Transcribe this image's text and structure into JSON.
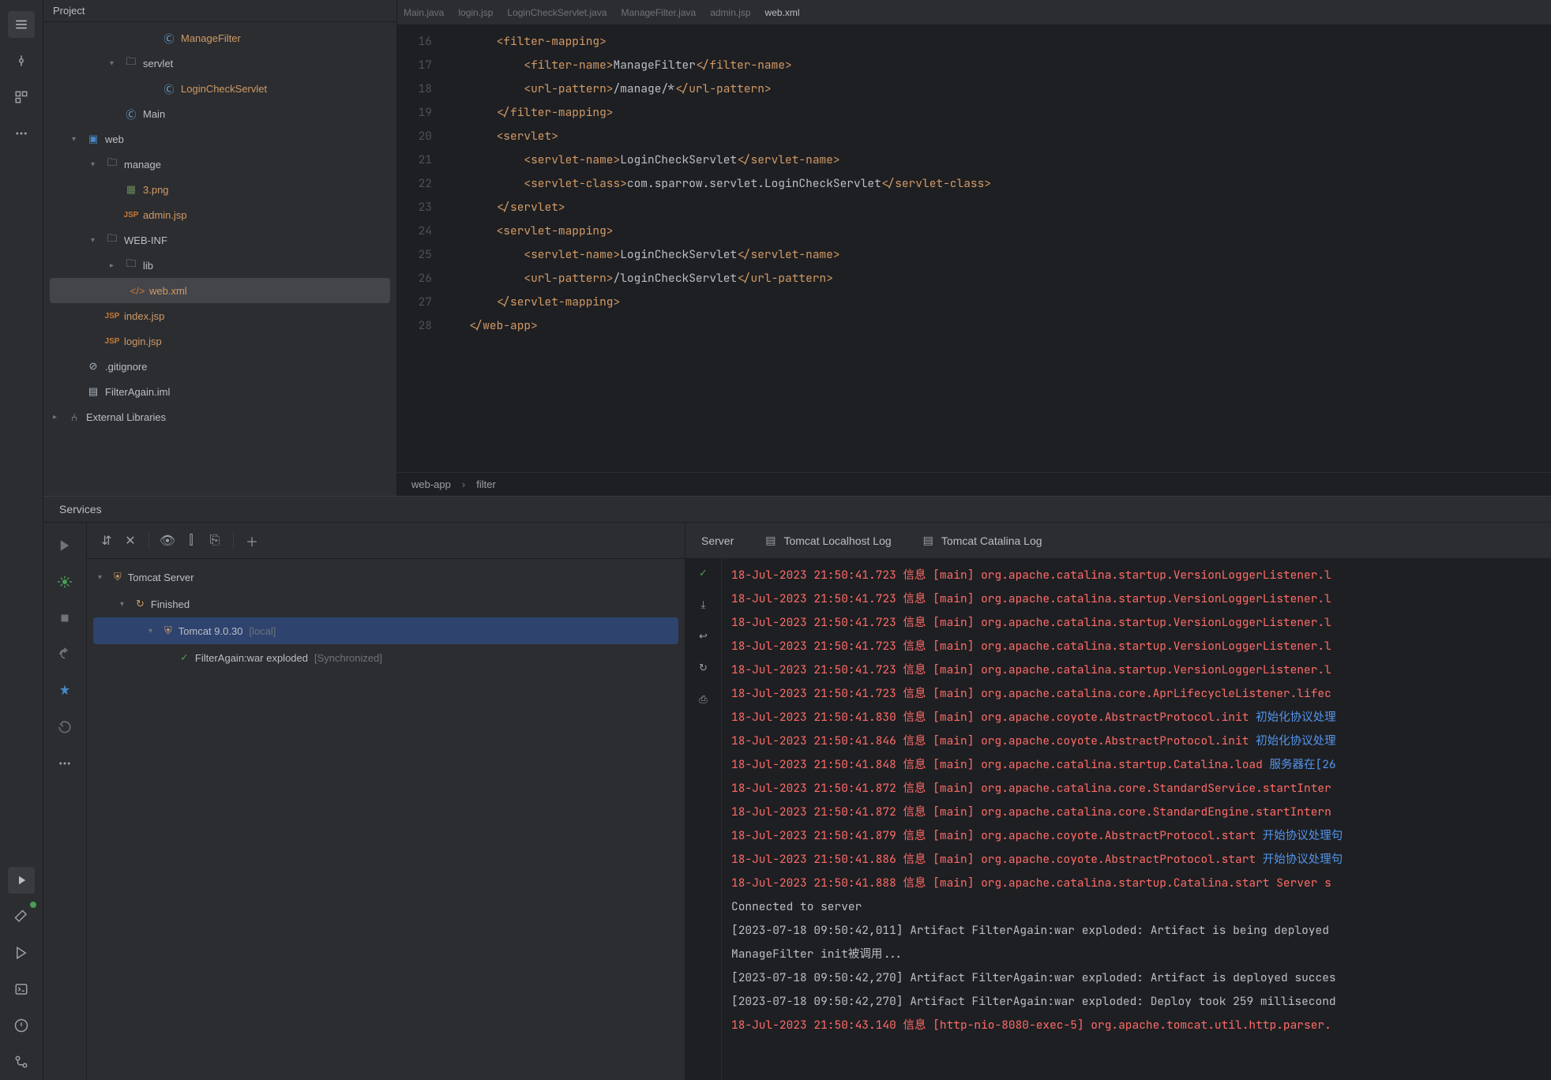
{
  "project": {
    "title": "Project",
    "tree": [
      {
        "indent": 5,
        "chev": "none",
        "iconClass": "class",
        "icon": "Ⓒ",
        "label": "ManageFilter",
        "labelClass": "orange"
      },
      {
        "indent": 3,
        "chev": "down",
        "iconClass": "folder",
        "icon": "🗀",
        "label": "servlet"
      },
      {
        "indent": 5,
        "chev": "none",
        "iconClass": "class",
        "icon": "Ⓒ",
        "label": "LoginCheckServlet",
        "labelClass": "orange"
      },
      {
        "indent": 3,
        "chev": "none",
        "iconClass": "class",
        "icon": "Ⓒ",
        "label": "Main"
      },
      {
        "indent": 1,
        "chev": "down",
        "iconClass": "web",
        "icon": "▣",
        "label": "web"
      },
      {
        "indent": 2,
        "chev": "down",
        "iconClass": "folder",
        "icon": "🗀",
        "label": "manage"
      },
      {
        "indent": 3,
        "chev": "none",
        "iconClass": "img",
        "icon": "▦",
        "label": "3.png",
        "labelClass": "orange"
      },
      {
        "indent": 3,
        "chev": "none",
        "iconClass": "jsp",
        "icon": "JSP",
        "label": "admin.jsp",
        "labelClass": "orange"
      },
      {
        "indent": 2,
        "chev": "down",
        "iconClass": "folder",
        "icon": "🗀",
        "label": "WEB-INF"
      },
      {
        "indent": 3,
        "chev": "right",
        "iconClass": "folder",
        "icon": "🗀",
        "label": "lib"
      },
      {
        "indent": 3,
        "chev": "none",
        "iconClass": "xml",
        "icon": "</>",
        "label": "web.xml",
        "highlighted": true,
        "labelClass": "orange"
      },
      {
        "indent": 2,
        "chev": "none",
        "iconClass": "jsp",
        "icon": "JSP",
        "label": "index.jsp",
        "labelClass": "orange"
      },
      {
        "indent": 2,
        "chev": "none",
        "iconClass": "jsp",
        "icon": "JSP",
        "label": "login.jsp",
        "labelClass": "orange"
      },
      {
        "indent": 1,
        "chev": "none",
        "iconClass": "lib",
        "icon": "⊘",
        "label": ".gitignore"
      },
      {
        "indent": 1,
        "chev": "none",
        "iconClass": "lib",
        "icon": "▤",
        "label": "FilterAgain.iml"
      },
      {
        "indent": 0,
        "chev": "right",
        "iconClass": "lib",
        "icon": "⑃",
        "label": "External Libraries"
      }
    ]
  },
  "editor": {
    "tabs": [
      "Main.java",
      "login.jsp",
      "LoginCheckServlet.java",
      "ManageFilter.java",
      "admin.jsp",
      "web.xml"
    ],
    "activeTab": 5,
    "startLine": 16,
    "lines": [
      {
        "ind": 2,
        "t": "filter-mapping"
      },
      {
        "ind": 3,
        "t": "filter-name",
        "txt": "ManageFilter",
        "c": "filter-name"
      },
      {
        "ind": 3,
        "t": "url-pattern",
        "txt": "/manage/*",
        "c": "url-pattern"
      },
      {
        "ind": 2,
        "tc": "filter-mapping"
      },
      {
        "ind": 2,
        "t": "servlet"
      },
      {
        "ind": 3,
        "t": "servlet-name",
        "txt": "LoginCheckServlet",
        "c": "servlet-name"
      },
      {
        "ind": 3,
        "t": "servlet-class",
        "txt": "com.sparrow.servlet.LoginCheckServlet",
        "c": "servlet-class"
      },
      {
        "ind": 2,
        "tc": "servlet"
      },
      {
        "ind": 2,
        "t": "servlet-mapping"
      },
      {
        "ind": 3,
        "t": "servlet-name",
        "txt": "LoginCheckServlet",
        "c": "servlet-name"
      },
      {
        "ind": 3,
        "t": "url-pattern",
        "txt": "/loginCheckServlet",
        "c": "url-pattern"
      },
      {
        "ind": 2,
        "tc": "servlet-mapping"
      },
      {
        "ind": 1,
        "tc": "web-app"
      }
    ],
    "breadcrumb": [
      "web-app",
      "filter"
    ]
  },
  "services": {
    "title": "Services",
    "tabs": {
      "server": "Server",
      "localhost": "Tomcat Localhost Log",
      "catalina": "Tomcat Catalina Log"
    },
    "tree": [
      {
        "indent": 0,
        "chev": "down",
        "icon": "⛨",
        "label": "Tomcat Server"
      },
      {
        "indent": 1,
        "chev": "down",
        "icon": "↻",
        "label": "Finished"
      },
      {
        "indent": 2,
        "chev": "down",
        "icon": "⛨",
        "label": "Tomcat 9.0.30",
        "suffix": "[local]",
        "selected": true
      },
      {
        "indent": 3,
        "chev": "none",
        "icon": "✓",
        "label": "FilterAgain:war exploded",
        "suffix": "[Synchronized]"
      }
    ],
    "log": [
      {
        "red": true,
        "text": "18-Jul-2023 21:50:41.723 信息 [main] org.apache.catalina.startup.VersionLoggerListener.l"
      },
      {
        "red": true,
        "text": "18-Jul-2023 21:50:41.723 信息 [main] org.apache.catalina.startup.VersionLoggerListener.l"
      },
      {
        "red": true,
        "text": "18-Jul-2023 21:50:41.723 信息 [main] org.apache.catalina.startup.VersionLoggerListener.l"
      },
      {
        "red": true,
        "text": "18-Jul-2023 21:50:41.723 信息 [main] org.apache.catalina.startup.VersionLoggerListener.l"
      },
      {
        "red": true,
        "text": "18-Jul-2023 21:50:41.723 信息 [main] org.apache.catalina.startup.VersionLoggerListener.l"
      },
      {
        "red": true,
        "text": "18-Jul-2023 21:50:41.723 信息 [main] org.apache.catalina.core.AprLifecycleListener.lifec"
      },
      {
        "red": true,
        "text": "18-Jul-2023 21:50:41.830 信息 [main] org.apache.coyote.AbstractProtocol.init ",
        "zh": "初始化协议处理"
      },
      {
        "red": true,
        "text": "18-Jul-2023 21:50:41.846 信息 [main] org.apache.coyote.AbstractProtocol.init ",
        "zh": "初始化协议处理"
      },
      {
        "red": true,
        "text": "18-Jul-2023 21:50:41.848 信息 [main] org.apache.catalina.startup.Catalina.load ",
        "zh": "服务器在[26"
      },
      {
        "red": true,
        "text": "18-Jul-2023 21:50:41.872 信息 [main] org.apache.catalina.core.StandardService.startInter"
      },
      {
        "red": true,
        "text": "18-Jul-2023 21:50:41.872 信息 [main] org.apache.catalina.core.StandardEngine.startIntern"
      },
      {
        "red": true,
        "text": "18-Jul-2023 21:50:41.879 信息 [main] org.apache.coyote.AbstractProtocol.start ",
        "zh": "开始协议处理句"
      },
      {
        "red": true,
        "text": "18-Jul-2023 21:50:41.886 信息 [main] org.apache.coyote.AbstractProtocol.start ",
        "zh": "开始协议处理句"
      },
      {
        "red": true,
        "text": "18-Jul-2023 21:50:41.888 信息 [main] org.apache.catalina.startup.Catalina.start Server s"
      },
      {
        "red": false,
        "text": "Connected to server"
      },
      {
        "red": false,
        "text": "[2023-07-18 09:50:42,011] Artifact FilterAgain:war exploded: Artifact is being deployed"
      },
      {
        "red": false,
        "text": "ManageFilter init被调用..."
      },
      {
        "red": false,
        "text": "[2023-07-18 09:50:42,270] Artifact FilterAgain:war exploded: Artifact is deployed succes"
      },
      {
        "red": false,
        "text": "[2023-07-18 09:50:42,270] Artifact FilterAgain:war exploded: Deploy took 259 millisecond"
      },
      {
        "red": true,
        "text": "18-Jul-2023 21:50:43.140 信息 [http-nio-8080-exec-5] org.apache.tomcat.util.http.parser."
      }
    ]
  }
}
